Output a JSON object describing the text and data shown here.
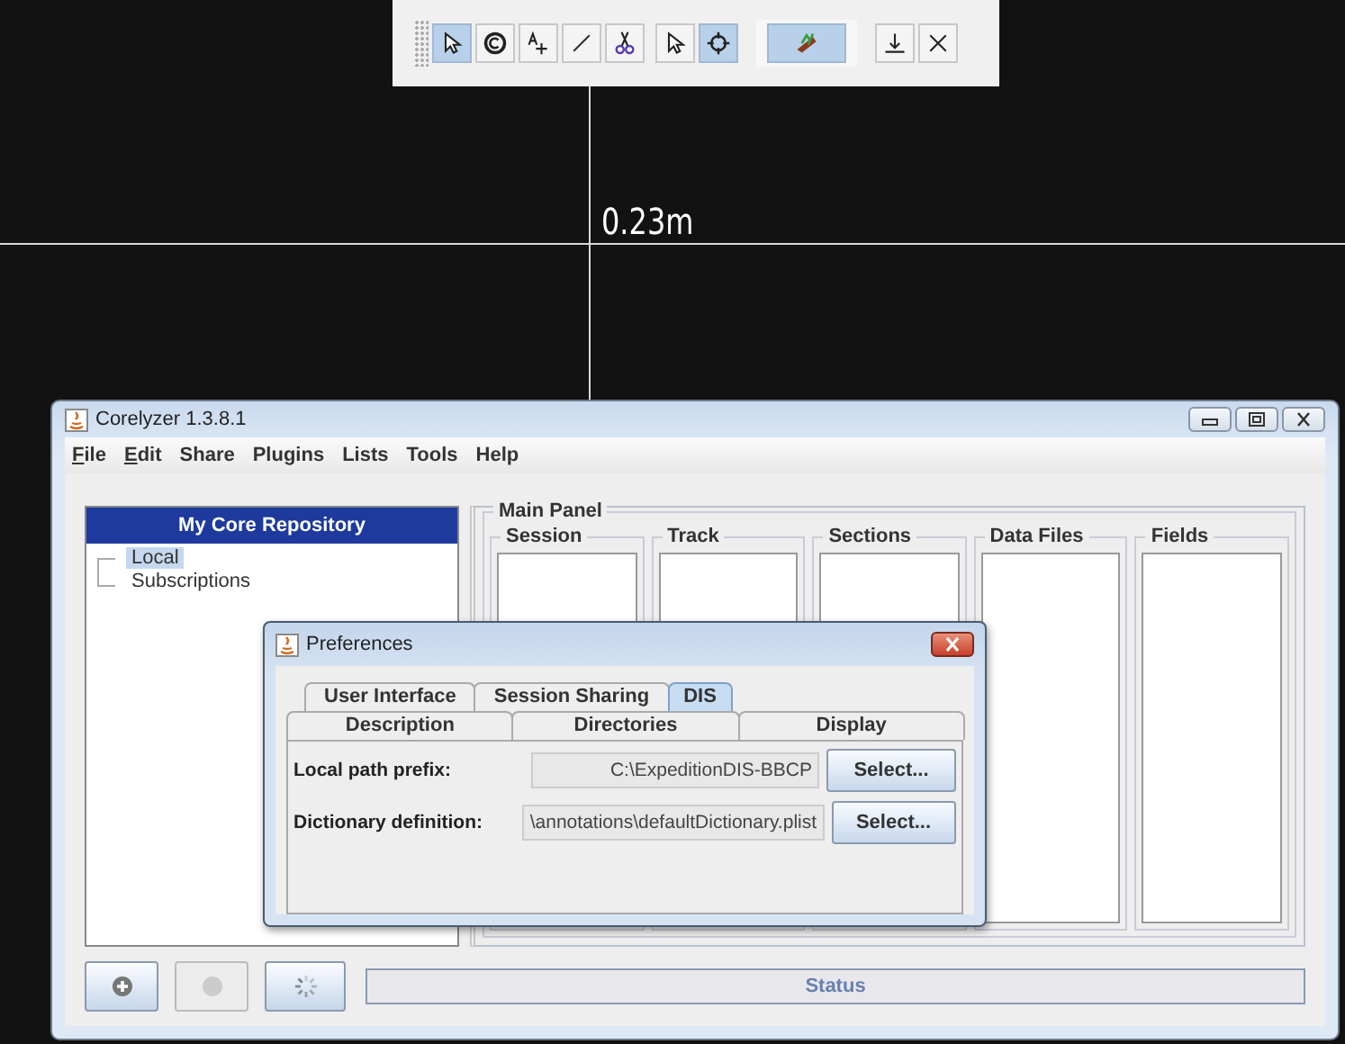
{
  "canvas": {
    "measurement": "0.23m"
  },
  "toolbar": {
    "groups": [
      {
        "tools": [
          {
            "kind": "pointer",
            "selected": true
          },
          {
            "kind": "copyright",
            "selected": false
          },
          {
            "kind": "text-add",
            "selected": false
          },
          {
            "kind": "line",
            "selected": false
          },
          {
            "kind": "scissors",
            "selected": false
          }
        ]
      },
      {
        "tools": [
          {
            "kind": "pointer",
            "selected": false
          },
          {
            "kind": "crosshair",
            "selected": true
          }
        ]
      },
      {
        "tools": [
          {
            "kind": "core",
            "selected": true
          }
        ]
      },
      {
        "tools": [
          {
            "kind": "anchor",
            "selected": false
          },
          {
            "kind": "close",
            "selected": false
          }
        ]
      }
    ]
  },
  "window": {
    "title": "Corelyzer 1.3.8.1",
    "menu": [
      {
        "label": "File",
        "mnemonic": true
      },
      {
        "label": "Edit",
        "mnemonic": true
      },
      {
        "label": "Share",
        "mnemonic": false
      },
      {
        "label": "Plugins",
        "mnemonic": false
      },
      {
        "label": "Lists",
        "mnemonic": false
      },
      {
        "label": "Tools",
        "mnemonic": false
      },
      {
        "label": "Help",
        "mnemonic": false
      }
    ],
    "repository": {
      "title": "My Core Repository",
      "items": [
        {
          "label": "Local",
          "selected": true
        },
        {
          "label": "Subscriptions",
          "selected": false
        }
      ]
    },
    "main_panel": {
      "title": "Main Panel",
      "columns": [
        "Session",
        "Track",
        "Sections",
        "Data Files",
        "Fields"
      ]
    },
    "buttons": [
      {
        "kind": "add",
        "disabled": false
      },
      {
        "kind": "record",
        "disabled": true
      },
      {
        "kind": "spinner",
        "disabled": false
      }
    ],
    "status": "Status"
  },
  "dialog": {
    "title": "Preferences",
    "tab_rows": [
      [
        {
          "label": "User Interface",
          "selected": false
        },
        {
          "label": "Session Sharing",
          "selected": false
        },
        {
          "label": "DIS",
          "selected": true
        }
      ],
      [
        {
          "label": "Description",
          "selected": false
        },
        {
          "label": "Directories",
          "selected": false
        },
        {
          "label": "Display",
          "selected": false
        }
      ]
    ],
    "fields": [
      {
        "label": "Local path prefix:",
        "value": "C:\\ExpeditionDIS-BBCP",
        "button": "Select..."
      },
      {
        "label": "Dictionary definition:",
        "value": "\\annotations\\defaultDictionary.plist",
        "button": "Select..."
      }
    ]
  }
}
